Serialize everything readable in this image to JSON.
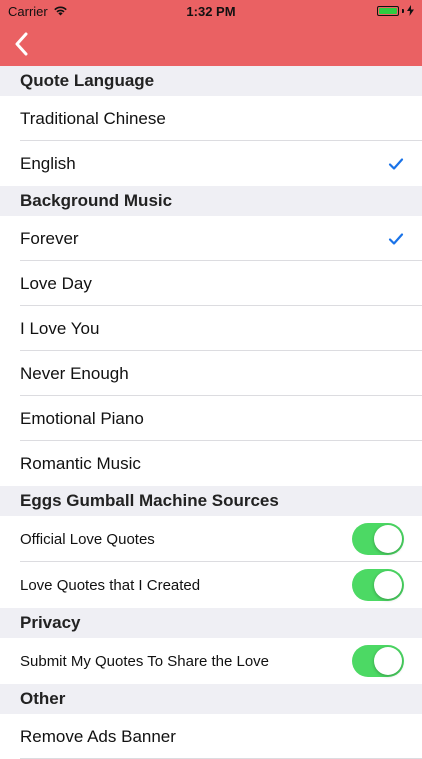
{
  "status_bar": {
    "carrier": "Carrier",
    "time": "1:32 PM"
  },
  "navbar": {
    "back_icon": "chevron-left-icon"
  },
  "colors": {
    "navbar": "#ea6163",
    "accent": "#1a73e8",
    "toggle_on": "#4cd964"
  },
  "sections": {
    "quote_language": {
      "title": "Quote Language",
      "items": [
        {
          "label": "Traditional Chinese",
          "checked": false
        },
        {
          "label": "English",
          "checked": true
        }
      ]
    },
    "background_music": {
      "title": "Background Music",
      "items": [
        {
          "label": "Forever",
          "checked": true
        },
        {
          "label": "Love Day",
          "checked": false
        },
        {
          "label": "I Love You",
          "checked": false
        },
        {
          "label": "Never Enough",
          "checked": false
        },
        {
          "label": "Emotional Piano",
          "checked": false
        },
        {
          "label": "Romantic Music",
          "checked": false
        }
      ]
    },
    "eggs_sources": {
      "title": "Eggs Gumball Machine Sources",
      "items": [
        {
          "label": "Official Love Quotes",
          "on": true
        },
        {
          "label": "Love Quotes that I Created",
          "on": true
        }
      ]
    },
    "privacy": {
      "title": "Privacy",
      "items": [
        {
          "label": "Submit My Quotes To Share the Love",
          "on": true
        }
      ]
    },
    "other": {
      "title": "Other",
      "items": [
        {
          "label": "Remove Ads Banner"
        }
      ]
    }
  }
}
